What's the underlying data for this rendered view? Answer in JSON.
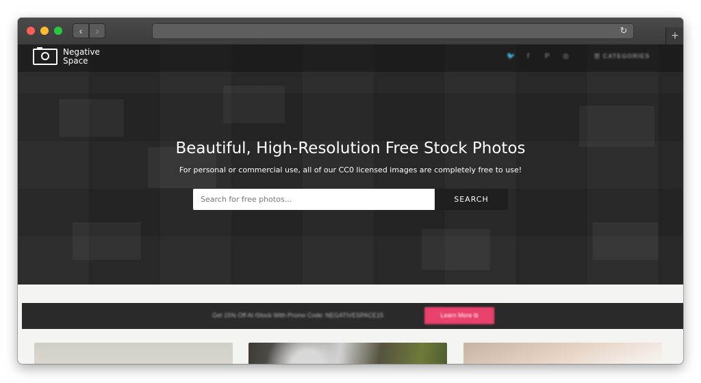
{
  "browser": {
    "back_icon": "‹",
    "forward_icon": "›",
    "reload_icon": "↻",
    "new_tab_icon": "+"
  },
  "site": {
    "logo_line1": "Negative",
    "logo_line2": "Space",
    "social_icons": [
      "twitter-icon",
      "facebook-icon",
      "pinterest-icon",
      "instagram-icon"
    ],
    "categories_label": "CATEGORIES"
  },
  "hero": {
    "title": "Beautiful, High-Resolution Free Stock Photos",
    "subtitle": "For personal or commercial use, all of our CC0 licensed images are completely free to use!"
  },
  "search": {
    "placeholder": "Search for free photos...",
    "button_label": "SEARCH"
  },
  "promo": {
    "text": "Get 15% Off At iStock With Promo Code: NEGATIVESPACE15",
    "button_label": "Learn More"
  },
  "colors": {
    "promo_button": "#e8416b",
    "search_button": "#1e1e1e"
  }
}
